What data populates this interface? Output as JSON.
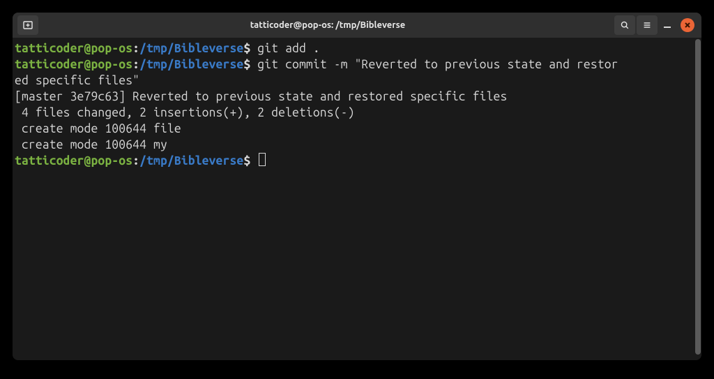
{
  "titlebar": {
    "title": "tatticoder@pop-os: /tmp/Bibleverse"
  },
  "prompt": {
    "user": "tatticoder",
    "at": "@",
    "host": "pop-os",
    "colon": ":",
    "path": "/tmp/Bibleverse",
    "dollar": "$"
  },
  "lines": {
    "cmd1": "git add .",
    "cmd2a": "git commit -m \"Reverted to previous state and restor",
    "cmd2b": "ed specific files\"",
    "out1": "[master 3e79c63] Reverted to previous state and restored specific files",
    "out2": " 4 files changed, 2 insertions(+), 2 deletions(-)",
    "out3": " create mode 100644 file",
    "out4": " create mode 100644 my"
  },
  "icons": {
    "newtab": "new-tab-icon",
    "search": "search-icon",
    "menu": "hamburger-icon",
    "minimize": "minimize-icon",
    "close": "close-icon"
  }
}
